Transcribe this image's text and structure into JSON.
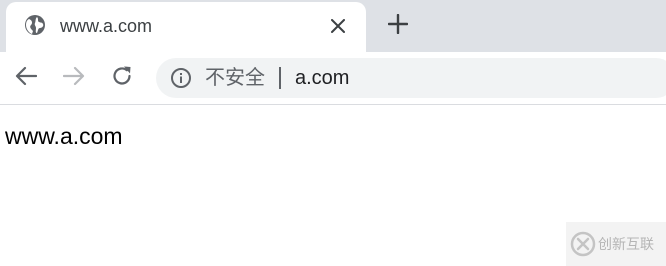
{
  "tab": {
    "title": "www.a.com",
    "favicon": "globe-icon",
    "close_icon": "close-icon"
  },
  "tabstrip": {
    "new_tab_icon": "plus-icon"
  },
  "toolbar": {
    "back_icon": "back-arrow-icon",
    "forward_icon": "forward-arrow-icon",
    "reload_icon": "reload-icon",
    "omnibox": {
      "info_icon": "info-icon",
      "security_label": "不安全",
      "url": "a.com"
    }
  },
  "page": {
    "body_text": "www.a.com"
  },
  "watermark": {
    "text": "创新互联"
  },
  "colors": {
    "tabstrip_bg": "#dee1e6",
    "omnibox_bg": "#f1f3f4",
    "icon": "#5f6368",
    "disabled_icon": "#b8babd"
  }
}
